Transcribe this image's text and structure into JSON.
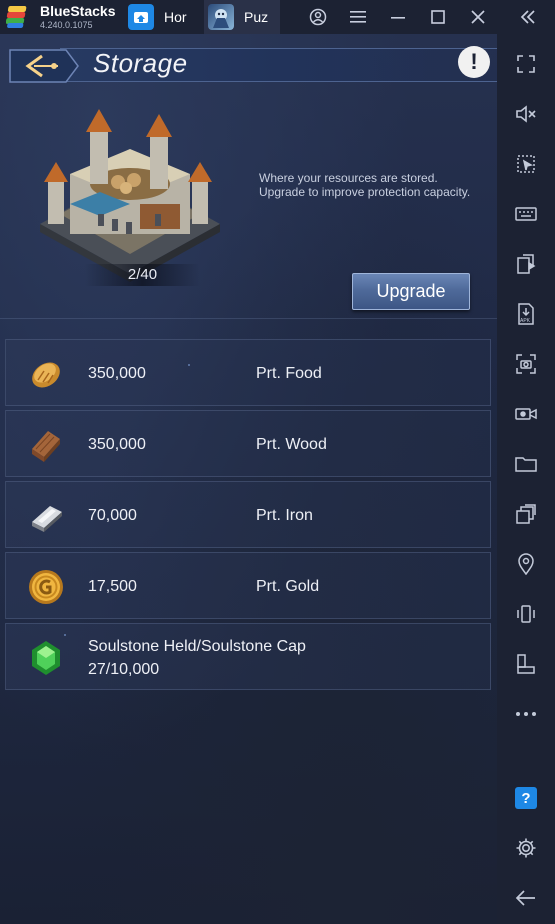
{
  "app": {
    "name": "BlueStacks",
    "version": "4.240.0.1075",
    "tabs": [
      {
        "label": "Hor",
        "icon": "home-icon"
      },
      {
        "label": "Puz",
        "icon": "game-icon"
      }
    ]
  },
  "window_controls": [
    "account-icon",
    "menu-icon",
    "minimize-icon",
    "maximize-icon",
    "close-icon",
    "collapse-icon"
  ],
  "sidebar": {
    "icons": [
      "fullscreen-icon",
      "volume-mute-icon",
      "pointer-icon",
      "keyboard-icon",
      "install-apk-icon",
      "apk-icon",
      "screenshot-icon",
      "record-icon",
      "folder-icon",
      "multi-instance-icon",
      "location-icon",
      "shake-icon",
      "rotate-icon",
      "more-icon",
      "help-icon",
      "settings-icon",
      "back-icon"
    ]
  },
  "storage": {
    "title": "Storage",
    "capacity": "2/40",
    "description": "Where your resources are stored. Upgrade to improve protection capacity.",
    "upgrade_label": "Upgrade",
    "resources": [
      {
        "amount": "350,000",
        "label": "Prt. Food",
        "icon": "bread-icon"
      },
      {
        "amount": "350,000",
        "label": "Prt. Wood",
        "icon": "wood-icon"
      },
      {
        "amount": "70,000",
        "label": "Prt. Iron",
        "icon": "iron-ingot-icon"
      },
      {
        "amount": "17,500",
        "label": "Prt. Gold",
        "icon": "gold-coin-icon"
      }
    ],
    "soulstone": {
      "label": "Soulstone Held/Soulstone Cap",
      "value": "27/10,000",
      "icon": "soulstone-icon"
    }
  }
}
